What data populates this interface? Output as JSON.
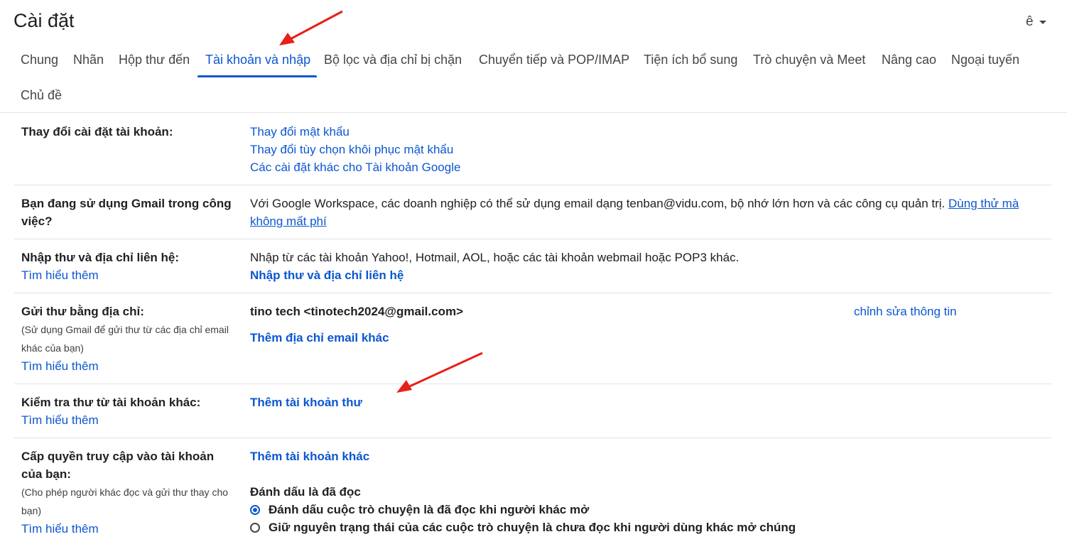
{
  "header": {
    "title": "Cài đặt",
    "lang_label": "ê"
  },
  "tabs": [
    {
      "label": "Chung"
    },
    {
      "label": "Nhãn"
    },
    {
      "label": "Hộp thư đến"
    },
    {
      "label": "Tài khoản và nhập",
      "active": true
    },
    {
      "label": "Bộ lọc và địa chỉ bị chặn"
    },
    {
      "label": "Chuyển tiếp và POP/IMAP"
    },
    {
      "label": "Tiện ích bổ sung"
    },
    {
      "label": "Trò chuyện và Meet"
    },
    {
      "label": "Nâng cao"
    },
    {
      "label": "Ngoại tuyến"
    },
    {
      "label": "Chủ đề"
    }
  ],
  "sections": {
    "account": {
      "label": "Thay đổi cài đặt tài khoản:",
      "links": [
        "Thay đổi mật khẩu",
        "Thay đổi tùy chọn khôi phục mật khẩu",
        "Các cài đặt khác cho Tài khoản Google"
      ]
    },
    "workspace": {
      "label": "Bạn đang sử dụng Gmail trong công việc?",
      "text": "Với Google Workspace, các doanh nghiệp có thể sử dụng email dạng tenban@vidu.com, bộ nhớ lớn hơn và các công cụ quản trị.",
      "link_part1": "Dùng thử mà",
      "link_part2": "không mất phí"
    },
    "import": {
      "label": "Nhập thư và địa chỉ liên hệ:",
      "learn": "Tìm hiểu thêm",
      "text": "Nhập từ các tài khoản Yahoo!, Hotmail, AOL, hoặc các tài khoản webmail hoặc POP3 khác.",
      "action": "Nhập thư và địa chỉ liên hệ"
    },
    "send_as": {
      "label": "Gửi thư bằng địa chỉ:",
      "sub": "(Sử dụng Gmail để gửi thư từ các địa chỉ email khác của bạn)",
      "learn": "Tìm hiểu thêm",
      "address": "tino tech <tinotech2024@gmail.com>",
      "edit": "chỉnh sửa thông tin",
      "add": "Thêm địa chỉ email khác"
    },
    "check_mail": {
      "label": "Kiểm tra thư từ tài khoản khác:",
      "learn": "Tìm hiểu thêm",
      "add": "Thêm tài khoản thư"
    },
    "grant": {
      "label": "Cấp quyền truy cập vào tài khoản của bạn:",
      "sub": "(Cho phép người khác đọc và gửi thư thay cho bạn)",
      "learn": "Tìm hiểu thêm",
      "add": "Thêm tài khoản khác",
      "mark_title": "Đánh dấu là đã đọc",
      "options": [
        {
          "label": "Đánh dấu cuộc trò chuyện là đã đọc khi người khác mở",
          "checked": true
        },
        {
          "label": "Giữ nguyên trạng thái của các cuộc trò chuyện là chưa đọc khi người dùng khác mở chúng",
          "checked": false
        }
      ]
    }
  },
  "colors": {
    "accent": "#0b57d0",
    "annotation_arrow": "#e8201a",
    "divider": "#e3e3e3"
  }
}
